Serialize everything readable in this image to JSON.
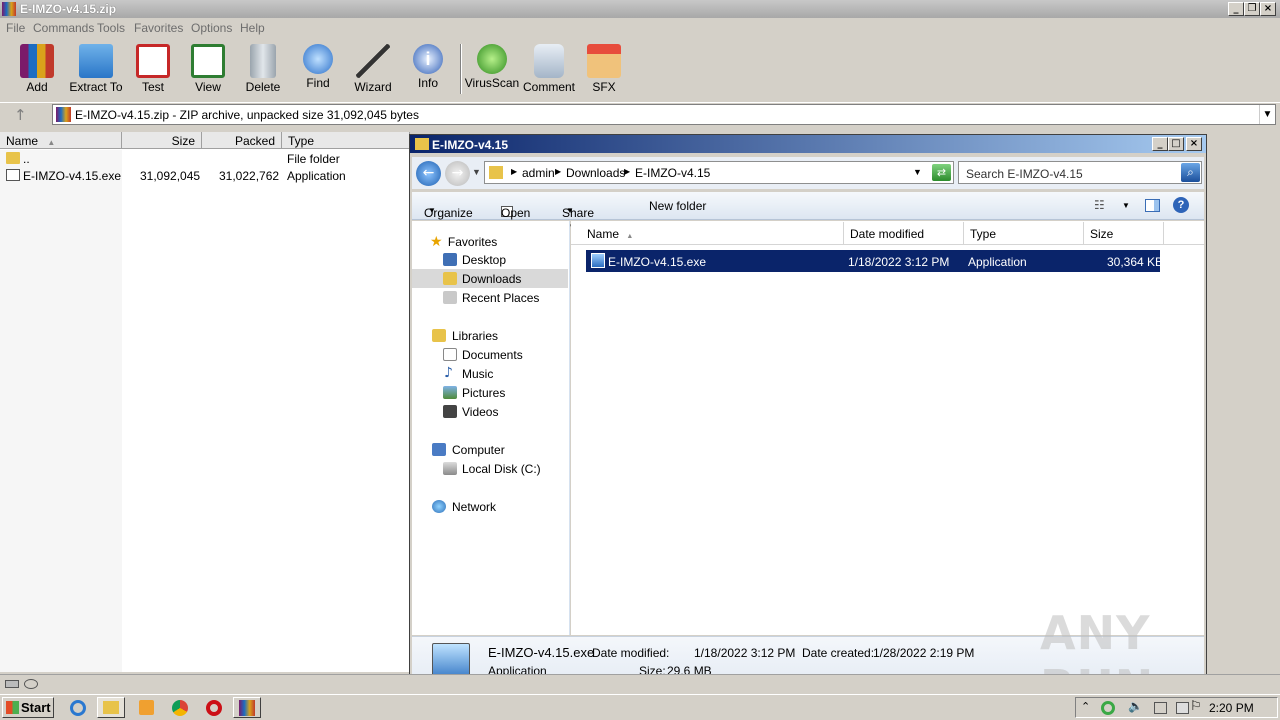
{
  "winrar": {
    "title": "E-IMZO-v4.15.zip",
    "menu": [
      "File",
      "Commands",
      "Tools",
      "Favorites",
      "Options",
      "Help"
    ],
    "toolbar": [
      "Add",
      "Extract To",
      "Test",
      "View",
      "Delete",
      "Find",
      "Wizard",
      "Info",
      "VirusScan",
      "Comment",
      "SFX"
    ],
    "address": "E-IMZO-v4.15.zip - ZIP archive, unpacked size 31,092,045 bytes",
    "columns": [
      "Name",
      "Size",
      "Packed",
      "Type"
    ],
    "rows": [
      {
        "name": "..",
        "size": "",
        "packed": "",
        "type": "File folder"
      },
      {
        "name": "E-IMZO-v4.15.exe",
        "size": "31,092,045",
        "packed": "31,022,762",
        "type": "Application"
      }
    ]
  },
  "explorer": {
    "title": "E-IMZO-v4.15",
    "breadcrumb": [
      "admin",
      "Downloads",
      "E-IMZO-v4.15"
    ],
    "search_placeholder": "Search E-IMZO-v4.15",
    "commands": {
      "organize": "Organize",
      "open": "Open",
      "share": "Share with",
      "newfolder": "New folder"
    },
    "nav": {
      "favorites": "Favorites",
      "desktop": "Desktop",
      "downloads": "Downloads",
      "recent": "Recent Places",
      "libraries": "Libraries",
      "documents": "Documents",
      "music": "Music",
      "pictures": "Pictures",
      "videos": "Videos",
      "computer": "Computer",
      "localdisk": "Local Disk (C:)",
      "network": "Network"
    },
    "columns": [
      "Name",
      "Date modified",
      "Type",
      "Size"
    ],
    "file": {
      "name": "E-IMZO-v4.15.exe",
      "date": "1/18/2022 3:12 PM",
      "type": "Application",
      "size": "30,364 KB"
    },
    "details": {
      "name": "E-IMZO-v4.15.exe",
      "type": "Application",
      "modified_label": "Date modified:",
      "modified": "1/18/2022 3:12 PM",
      "size_label": "Size:",
      "size": "29.6 MB",
      "created_label": "Date created:",
      "created": "1/28/2022 2:19 PM"
    }
  },
  "taskbar": {
    "start": "Start",
    "time": "2:20 PM"
  },
  "watermark": "ANY RUN"
}
